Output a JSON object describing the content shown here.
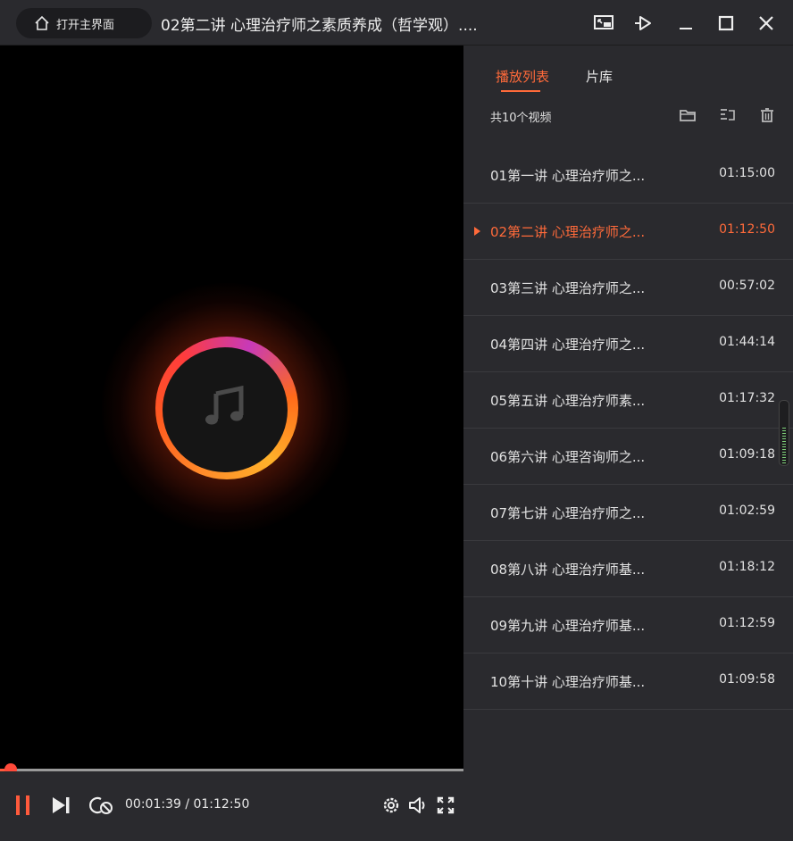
{
  "window": {
    "home_label": "打开主界面",
    "title": "02第二讲 心理治疗师之素质养成（哲学观）...."
  },
  "player": {
    "current_time": "00:01:39",
    "total_time": "01:12:50",
    "time_text": "00:01:39 / 01:12:50",
    "progress_fraction": 0.023
  },
  "panel": {
    "tabs": [
      {
        "label": "播放列表",
        "active": true
      },
      {
        "label": "片库",
        "active": false
      }
    ],
    "count_text": "共10个视频",
    "items": [
      {
        "name": "01第一讲 心理治疗师之...",
        "duration": "01:15:00"
      },
      {
        "name": "02第二讲 心理治疗师之...",
        "duration": "01:12:50"
      },
      {
        "name": "03第三讲 心理治疗师之...",
        "duration": "00:57:02"
      },
      {
        "name": "04第四讲 心理治疗师之...",
        "duration": "01:44:14"
      },
      {
        "name": "05第五讲 心理治疗师素...",
        "duration": "01:17:32"
      },
      {
        "name": "06第六讲 心理咨询师之...",
        "duration": "01:09:18"
      },
      {
        "name": "07第七讲 心理治疗师之...",
        "duration": "01:02:59"
      },
      {
        "name": "08第八讲 心理治疗师基...",
        "duration": "01:18:12"
      },
      {
        "name": "09第九讲 心理治疗师基...",
        "duration": "01:12:59"
      },
      {
        "name": "10第十讲 心理治疗师基...",
        "duration": "01:09:58"
      }
    ],
    "playing_index": 1
  },
  "colors": {
    "accent": "#ff6a3a",
    "background": "#2a2a2e",
    "player_bg": "#000000"
  },
  "icons": [
    "home-icon",
    "miniplayer-icon",
    "pin-icon",
    "minimize-icon",
    "maximize-icon",
    "close-icon",
    "music-note-icon",
    "pause-icon",
    "next-icon",
    "loop-icon",
    "settings-icon",
    "volume-icon",
    "fullscreen-icon",
    "folder-icon",
    "add-list-icon",
    "trash-icon"
  ]
}
